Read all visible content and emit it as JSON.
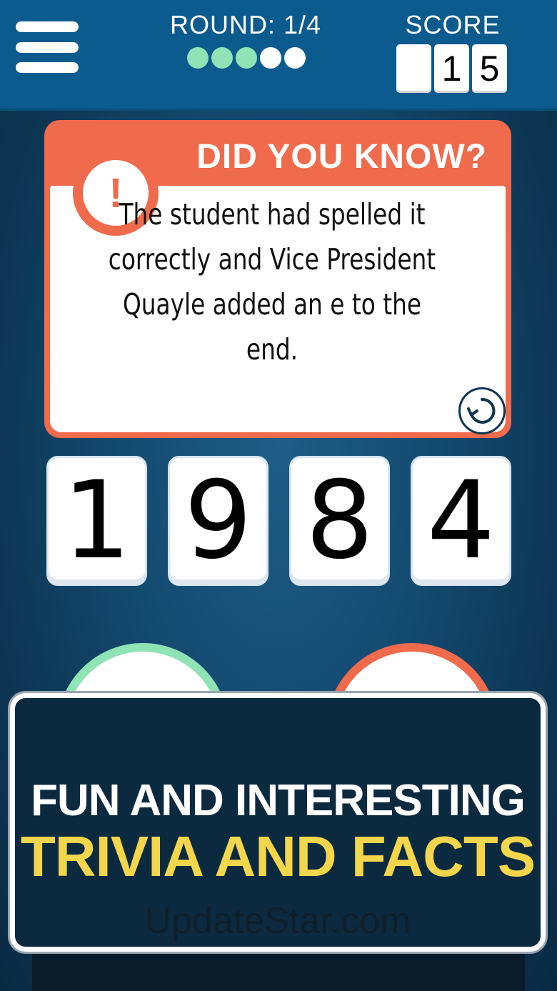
{
  "header": {
    "round_label": "ROUND: 1/4",
    "round_dots_total": 5,
    "round_dots_filled": 3,
    "score_label": "SCORE",
    "score_digits": [
      "",
      "1",
      "5"
    ]
  },
  "fact_card": {
    "title": "DID YOU KNOW?",
    "badge_symbol": "!",
    "text": "The student had spelled it correctly and Vice President Quayle added an e to the end."
  },
  "answer_tiles": [
    "1",
    "9",
    "8",
    "4"
  ],
  "promo": {
    "line1": "FUN AND INTERESTING",
    "line2": "TRIVIA AND FACTS",
    "watermark": "UpdateStar.com"
  },
  "colors": {
    "header_blue": "#0c5b8e",
    "card_orange": "#f06a4c",
    "accent_green": "#8fe3b5",
    "promo_yellow": "#f4d64c",
    "promo_bg": "#0c2a3f"
  },
  "icons": {
    "menu": "hamburger-icon",
    "alert": "exclamation-icon",
    "refresh": "refresh-icon"
  }
}
